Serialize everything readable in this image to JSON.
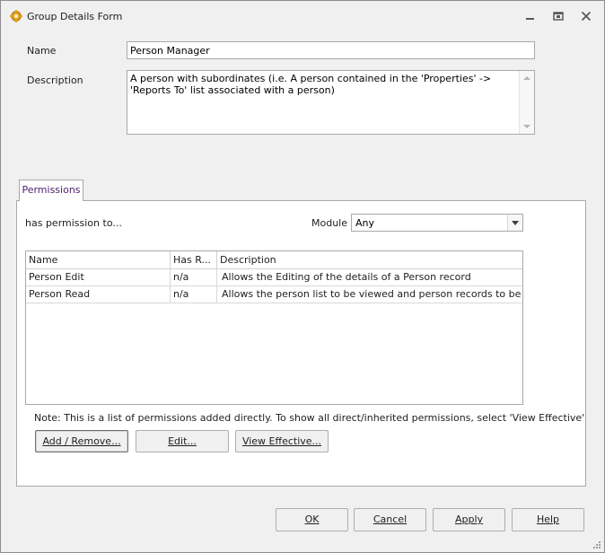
{
  "window": {
    "title": "Group Details Form"
  },
  "form": {
    "name_label": "Name",
    "name_value": "Person Manager",
    "description_label": "Description",
    "description_value": "A person with subordinates (i.e. A person contained in the 'Properties' -> 'Reports To' list associated with a person)"
  },
  "tabs": [
    {
      "label": "Permissions",
      "active": true
    }
  ],
  "permissions": {
    "heading": "has permission to...",
    "module_label": "Module",
    "module_value": "Any",
    "columns": [
      "Name",
      "Has R...",
      "Description"
    ],
    "rows": [
      {
        "name": "Person Edit",
        "has_rights": "n/a",
        "description": "Allows the Editing of the details of a Person record"
      },
      {
        "name": "Person Read",
        "has_rights": "n/a",
        "description": "Allows the person list to be viewed and person records to be opened."
      }
    ],
    "note": "Note: This is a list of permissions added directly. To show all direct/inherited permissions, select 'View Effective'",
    "add_remove_label": "Add / Remove...",
    "edit_label": "Edit...",
    "view_effective_label": "View  Effective..."
  },
  "footer": {
    "ok_label": "OK",
    "cancel_label": "Cancel",
    "apply_label": "Apply",
    "help_label": "Help"
  },
  "icons": {
    "app": "gear-group-icon",
    "minimize": "minimize-icon",
    "restore": "restore-icon",
    "close": "close-icon",
    "combo": "chevron-down-icon",
    "grip": "resize-grip-icon"
  },
  "colors": {
    "tab_text": "#4c1f6f",
    "window_bg": "#f0f0f0"
  }
}
